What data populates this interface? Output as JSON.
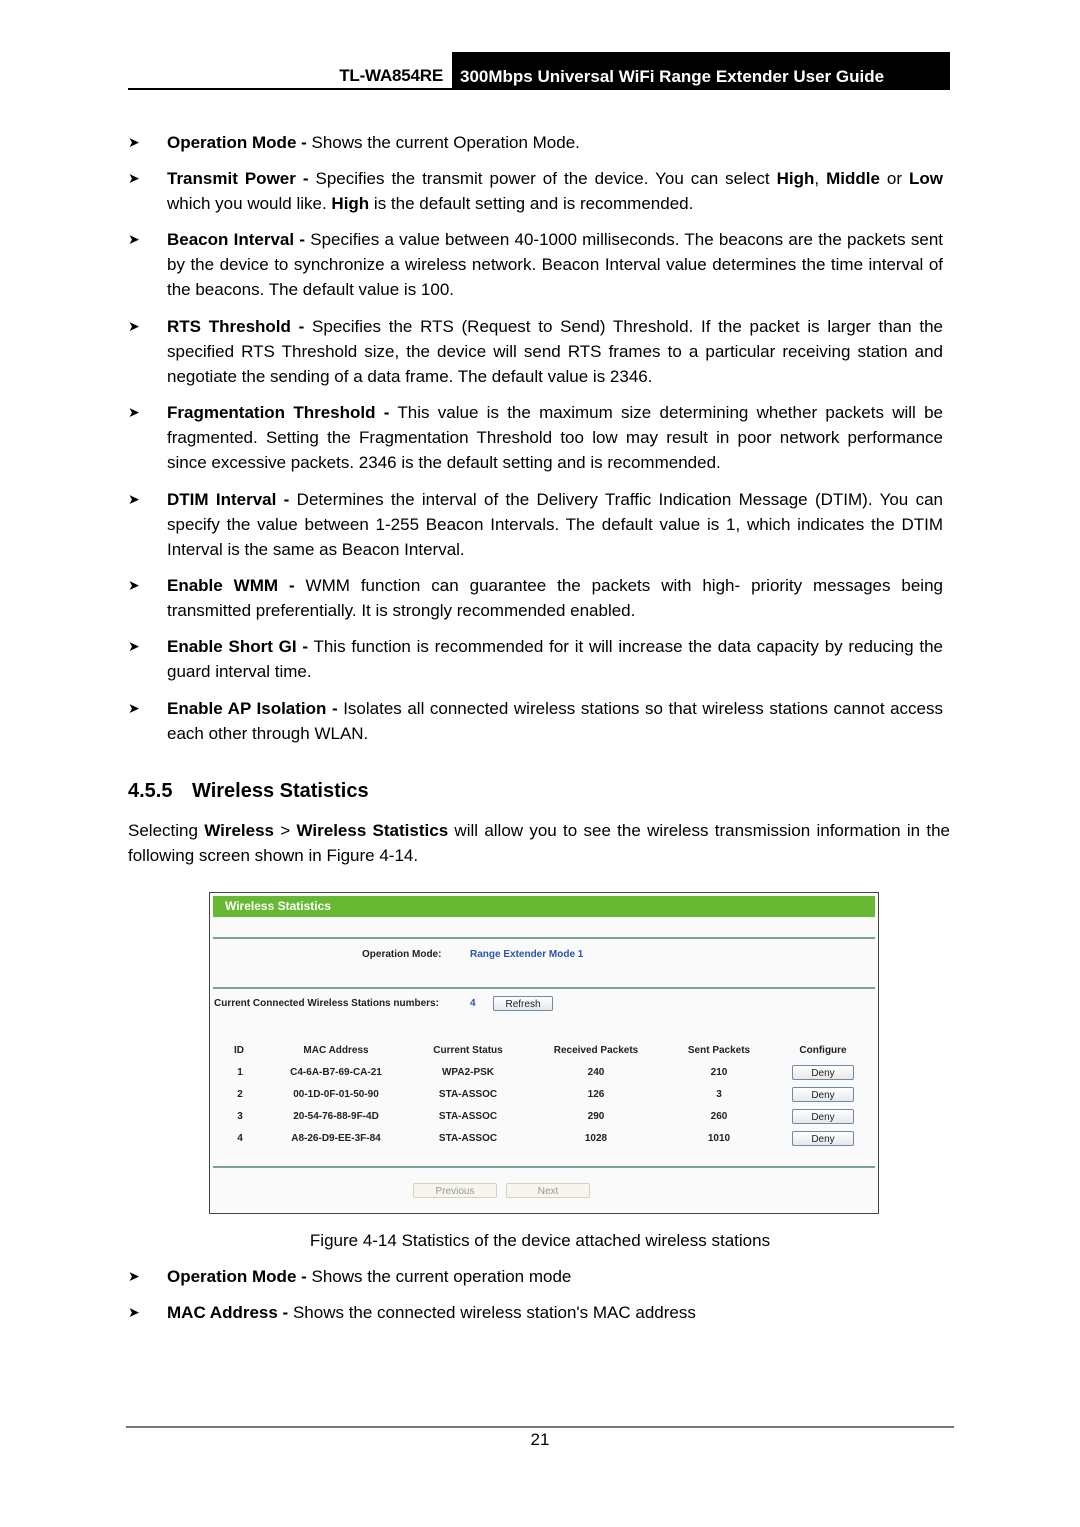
{
  "header": {
    "model": "TL-WA854RE",
    "title": "300Mbps Universal WiFi Range Extender User Guide"
  },
  "bullets_top": [
    {
      "term": "Operation Mode -",
      "text": " Shows the current Operation Mode."
    },
    {
      "term": "Transmit Power -",
      "parts": [
        " Specifies the transmit power of the device. You can select ",
        "High",
        ", ",
        "Middle",
        " or ",
        "Low",
        " which you would like. ",
        "High",
        " is the default setting and is recommended."
      ]
    },
    {
      "term": "Beacon Interval -",
      "text": " Specifies a value between 40-1000 milliseconds. The beacons are the packets sent by the device to synchronize a wireless network. Beacon Interval value determines the time interval of the beacons. The default value is 100."
    },
    {
      "term": "RTS Threshold -",
      "text": " Specifies the RTS (Request to Send) Threshold. If the packet is larger than the specified RTS Threshold size, the device will send RTS frames to a particular receiving station and negotiate the sending of a data frame. The default value is 2346."
    },
    {
      "term": "Fragmentation Threshold -",
      "text": " This value is the maximum size determining whether packets will be fragmented. Setting the Fragmentation Threshold too low may result in poor network performance since excessive packets. 2346 is the default setting and is recommended."
    },
    {
      "term": "DTIM Interval -",
      "text": " Determines the interval of the Delivery Traffic Indication Message (DTIM). You can specify the value between 1-255 Beacon Intervals. The default value is 1, which indicates the DTIM Interval is the same as Beacon Interval."
    },
    {
      "term": "Enable WMM -",
      "text": " WMM function can guarantee the packets with high- priority messages being transmitted preferentially. It is strongly recommended enabled."
    },
    {
      "term": "Enable Short GI -",
      "text": " This function is recommended for it will increase the data capacity by reducing the guard interval time."
    },
    {
      "term": "Enable AP Isolation -",
      "text": " Isolates all connected wireless stations so that wireless stations cannot access each other through WLAN."
    }
  ],
  "section": {
    "number": "4.5.5",
    "title": "Wireless Statistics",
    "intro": {
      "p1": "Selecting ",
      "b1": "Wireless",
      "p2": " > ",
      "b2": "Wireless Statistics",
      "p3": " will allow you to see the wireless transmission information in the following screen shown in Figure 4-14."
    }
  },
  "figure": {
    "panel_title": "Wireless Statistics",
    "operation_mode_label": "Operation Mode:",
    "operation_mode_value": "Range Extender Mode 1",
    "stations_label": "Current Connected Wireless Stations numbers:",
    "stations_count": "4",
    "refresh_label": "Refresh",
    "columns": [
      "ID",
      "MAC Address",
      "Current Status",
      "Received Packets",
      "Sent Packets",
      "Configure"
    ],
    "rows": [
      {
        "id": "1",
        "mac": "C4-6A-B7-69-CA-21",
        "status": "WPA2-PSK",
        "received": "240",
        "sent": "210",
        "action": "Deny"
      },
      {
        "id": "2",
        "mac": "00-1D-0F-01-50-90",
        "status": "STA-ASSOC",
        "received": "126",
        "sent": "3",
        "action": "Deny"
      },
      {
        "id": "3",
        "mac": "20-54-76-88-9F-4D",
        "status": "STA-ASSOC",
        "received": "290",
        "sent": "260",
        "action": "Deny"
      },
      {
        "id": "4",
        "mac": "A8-26-D9-EE-3F-84",
        "status": "STA-ASSOC",
        "received": "1028",
        "sent": "1010",
        "action": "Deny"
      }
    ],
    "previous_label": "Previous",
    "next_label": "Next",
    "colors": {
      "header_bar": "#67b832",
      "accent_text": "#2a56b0",
      "rule": "#7aa58c"
    }
  },
  "caption": "Figure 4-14 Statistics of the device attached wireless stations",
  "bullets_bottom": [
    {
      "term": "Operation Mode -",
      "text": " Shows the current operation mode"
    },
    {
      "term": "MAC Address -",
      "text": " Shows the connected wireless station's MAC address"
    }
  ],
  "footer": {
    "page_number": "21"
  }
}
